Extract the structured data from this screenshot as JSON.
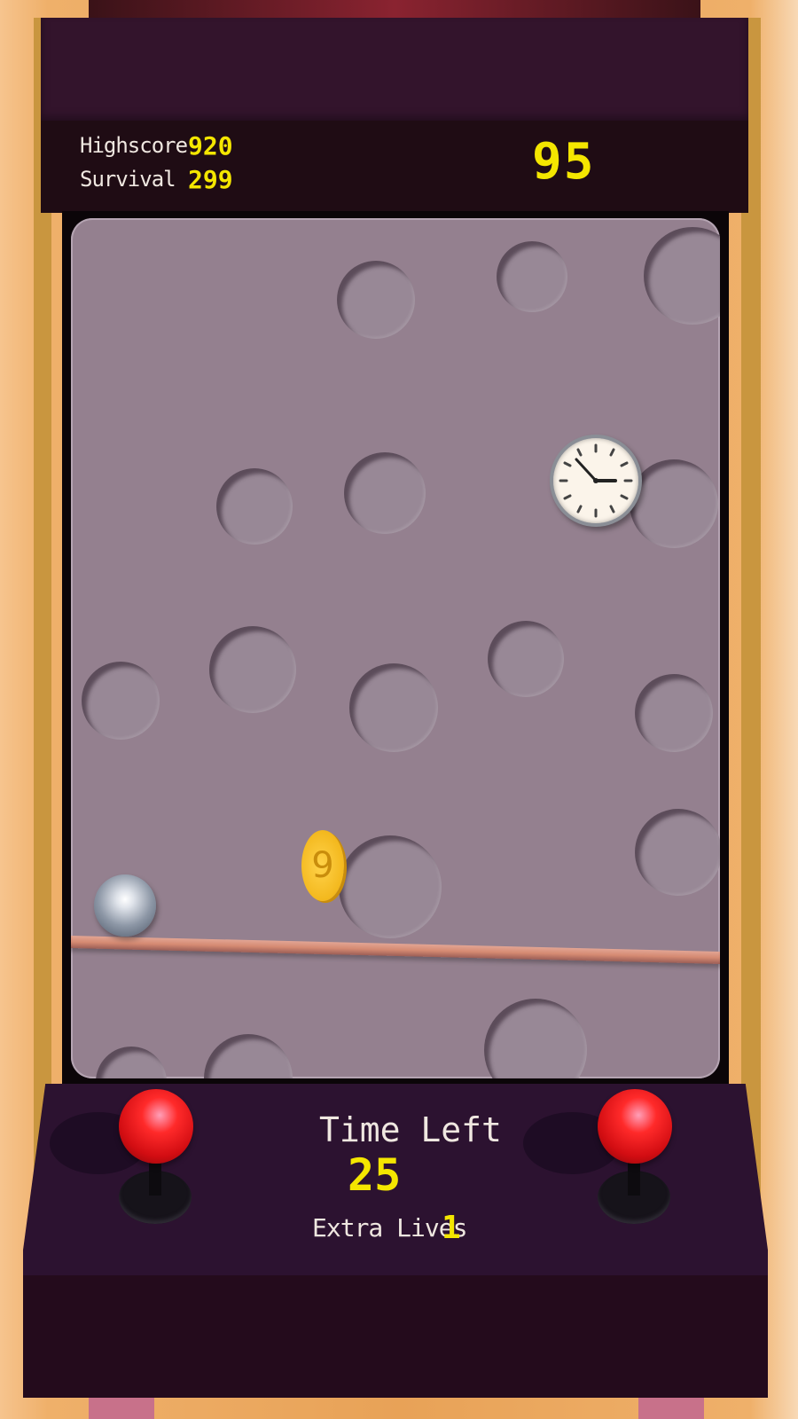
{
  "hud": {
    "highscore_label": "Highscore",
    "highscore_value": "920",
    "survival_label": "Survival",
    "survival_value": "299",
    "score_value": "95"
  },
  "panel": {
    "time_left_label": "Time Left",
    "time_left_value": "25",
    "extra_lives_label": "Extra Lives",
    "extra_lives_value": "1"
  },
  "playfield": {
    "coin_label": "9"
  },
  "colors": {
    "hud_value": "#f4e600",
    "cabinet": "#2c1230",
    "playfield": "#94808f",
    "joystick_knob": "#ff2a2a"
  },
  "icons": [
    "clock-pickup-icon",
    "coin-icon",
    "player-ball",
    "joystick-knob"
  ]
}
